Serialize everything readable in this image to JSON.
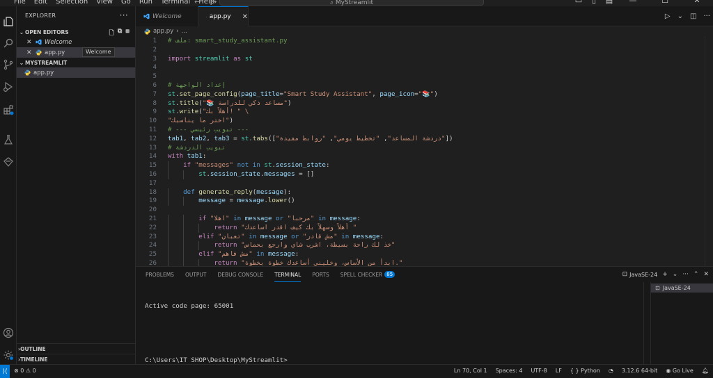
{
  "titlebar": {
    "menu": [
      "File",
      "Edit",
      "Selection",
      "View",
      "Go",
      "Run",
      "Terminal",
      "Help"
    ],
    "search_text": "MyStreamlit"
  },
  "sidebar": {
    "title": "EXPLORER",
    "open_editors_label": "OPEN EDITORS",
    "open_editors": [
      {
        "label": "Welcome",
        "icon": "vscode-icon"
      },
      {
        "label": "app.py",
        "icon": "python-icon"
      }
    ],
    "tooltip": "Welcome",
    "folder_label": "MYSTREAMLIT",
    "files": [
      {
        "label": "app.py",
        "icon": "python-icon"
      }
    ],
    "outline_label": "OUTLINE",
    "timeline_label": "TIMELINE"
  },
  "tabs": [
    {
      "label": "Welcome",
      "active": false
    },
    {
      "label": "app.py",
      "active": true
    }
  ],
  "breadcrumb": {
    "file": "app.py",
    "more": "..."
  },
  "editor": {
    "lines": [
      {
        "n": "1",
        "html": "<span class='c-com'># ملف: smart_study_assistant.py</span>"
      },
      {
        "n": "2",
        "html": ""
      },
      {
        "n": "3",
        "html": "<span class='c-kw'>import</span> <span class='c-mod'>streamlit</span> <span class='c-kw'>as</span> <span class='c-mod'>st</span>"
      },
      {
        "n": "4",
        "html": ""
      },
      {
        "n": "5",
        "html": ""
      },
      {
        "n": "6",
        "html": "<span class='c-com'># إعداد الواجهة</span>"
      },
      {
        "n": "7",
        "html": "<span class='c-mod'>st</span>.<span class='c-fn'>set_page_config</span>(<span class='c-var'>page_title</span>=<span class='c-str'>\"Smart Study Assistant\"</span>, <span class='c-var'>page_icon</span>=<span class='c-str'>\"📚\"</span>)"
      },
      {
        "n": "8",
        "html": "<span class='c-mod'>st</span>.<span class='c-fn'>title</span>(<span class='c-str'>\"📚 مساعد ذكي للدراسة\"</span>)"
      },
      {
        "n": "9",
        "html": "<span class='c-mod'>st</span>.<span class='c-fn'>write</span>(<span class='c-str'>\"أهلاً بك! \" \\</span>"
      },
      {
        "n": "10",
        "html": "<span class='c-str'>\"اختر ما يناسبك\"</span>)"
      },
      {
        "n": "11",
        "html": "<span class='c-com'># --- تبويب رئيسي ---</span>"
      },
      {
        "n": "12",
        "html": "<span class='c-var'>tab1</span>, <span class='c-var'>tab2</span>, <span class='c-var'>tab3</span> = <span class='c-mod'>st</span>.<span class='c-fn'>tabs</span>([<span class='c-str'>\"دردشة المساعد\"</span>, <span class='c-str'>\"تخطيط يومي\"</span>, <span class='c-str'>\"روابط مفيدة\"</span>])"
      },
      {
        "n": "13",
        "html": "<span class='c-com'># تبويب الدردشة</span>"
      },
      {
        "n": "14",
        "html": "<span class='c-kw'>with</span> <span class='c-var'>tab1</span>:"
      },
      {
        "n": "15",
        "html": "    <span class='c-kw'>if</span> <span class='c-str'>\"messages\"</span> <span class='c-kw2'>not</span> <span class='c-kw2'>in</span> <span class='c-mod'>st</span>.<span class='c-var'>session_state</span>:"
      },
      {
        "n": "16",
        "html": "        <span class='c-mod'>st</span>.<span class='c-var'>session_state</span>.<span class='c-var'>messages</span> = []"
      },
      {
        "n": "17",
        "html": ""
      },
      {
        "n": "18",
        "html": "    <span class='c-kw2'>def</span> <span class='c-fn'>generate_reply</span>(<span class='c-var'>message</span>):"
      },
      {
        "n": "19",
        "html": "        <span class='c-var'>message</span> = <span class='c-var'>message</span>.<span class='c-fn'>lower</span>()"
      },
      {
        "n": "20",
        "html": ""
      },
      {
        "n": "21",
        "html": "        <span class='c-kw'>if</span> <span class='c-str'>\"اهلا\"</span> <span class='c-kw2'>in</span> <span class='c-var'>message</span> <span class='c-kw2'>or</span> <span class='c-str'>\"مرحبا\"</span> <span class='c-kw2'>in</span> <span class='c-var'>message</span>:"
      },
      {
        "n": "22",
        "html": "            <span class='c-kw'>return</span> <span class='c-str'>\"أهلاً وسهلاً بك كيف اقدر اساعدك \"</span>"
      },
      {
        "n": "23",
        "html": "        <span class='c-kw'>elif</span> <span class='c-str'>\"تعبان\"</span> <span class='c-kw2'>in</span> <span class='c-var'>message</span> <span class='c-kw2'>or</span> <span class='c-str'>\"مش قادر\"</span> <span class='c-kw2'>in</span> <span class='c-var'>message</span>:"
      },
      {
        "n": "24",
        "html": "            <span class='c-kw'>return</span> <span class='c-str'>\"خذ لك راحة بسيطة، اشرب شاي وارجع بحماس\"</span>"
      },
      {
        "n": "25",
        "html": "        <span class='c-kw'>elif</span> <span class='c-str'>\"مش فاهم\"</span> <span class='c-kw2'>in</span> <span class='c-var'>message</span>:"
      },
      {
        "n": "26",
        "html": "            <span class='c-kw'>return</span> <span class='c-str'>\"ابدأ من الأساس، وخليني أساعدك خطوة بخطوة.\"</span>"
      }
    ]
  },
  "panel": {
    "tabs": [
      {
        "label": "PROBLEMS",
        "active": false
      },
      {
        "label": "OUTPUT",
        "active": false
      },
      {
        "label": "DEBUG CONSOLE",
        "active": false
      },
      {
        "label": "TERMINAL",
        "active": true
      },
      {
        "label": "PORTS",
        "active": false
      },
      {
        "label": "SPELL CHECKER",
        "active": false,
        "badge": "85"
      }
    ],
    "terminal_name": "JavaSE-24",
    "terminal_list_item": "JavaSE-24",
    "terminal_lines": [
      "Active code page: 65001",
      "",
      "C:\\Users\\IT SHOP\\Desktop\\MyStreamlit>"
    ]
  },
  "status": {
    "errors": "0",
    "warnings": "0",
    "position": "Ln 70, Col 1",
    "spaces": "Spaces: 4",
    "encoding": "UTF-8",
    "eol": "LF",
    "language": "Python",
    "interpreter": "3.12.6 64-bit",
    "golive": "Go Live"
  },
  "colors": {
    "accent": "#0078d4",
    "badge": "#0078d4"
  }
}
